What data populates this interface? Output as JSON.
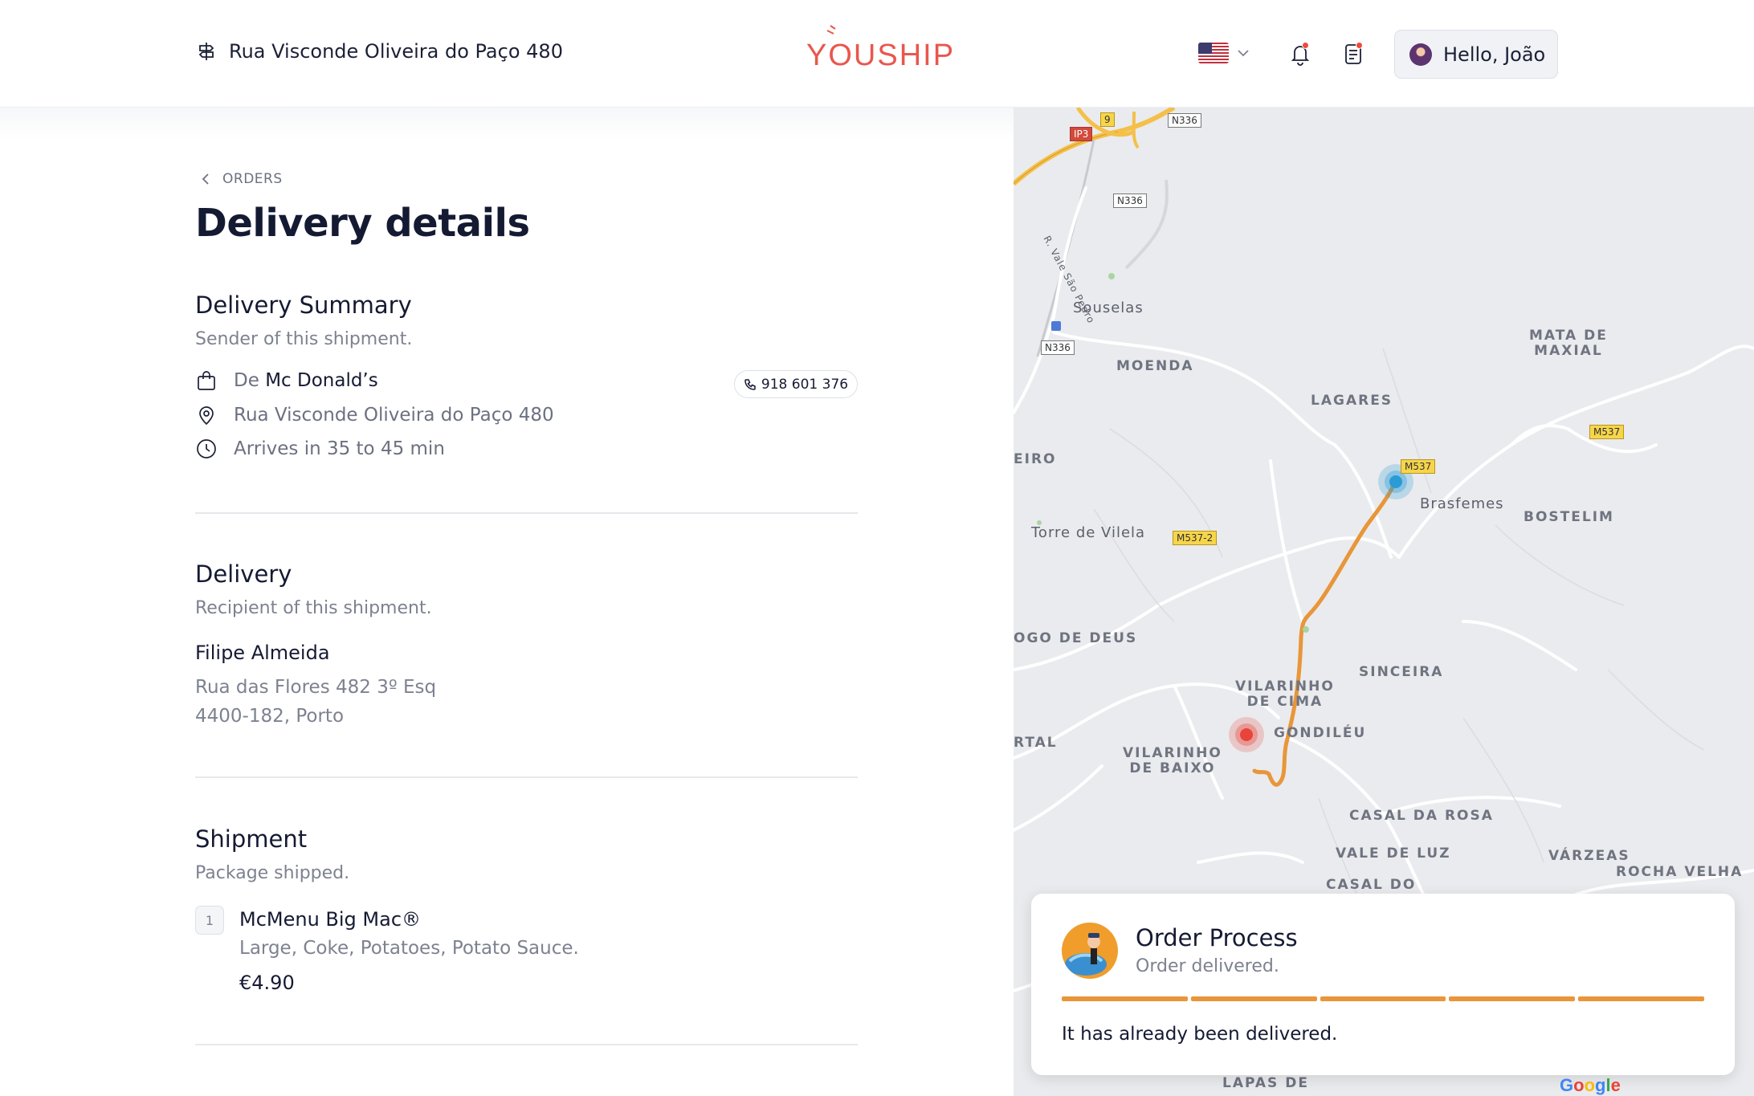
{
  "header": {
    "address": "Rua Visconde Oliveira do Paço 480",
    "brand": "YOUSHIP",
    "language_flag": "us-flag-icon",
    "greeting": "Hello, João"
  },
  "page": {
    "back_label": "ORDERS",
    "title": "Delivery details"
  },
  "summary": {
    "title": "Delivery Summary",
    "subtitle": "Sender of this shipment.",
    "from_prefix": "De",
    "from_name": "Mc Donald’s",
    "phone": "918 601 376",
    "address": "Rua Visconde Oliveira do Paço 480",
    "eta": "Arrives in 35 to 45 min"
  },
  "delivery": {
    "title": "Delivery",
    "subtitle": "Recipient of this shipment.",
    "recipient": "Filipe Almeida",
    "address_line1": "Rua das Flores 482 3º Esq",
    "address_line2": "4400-182, Porto"
  },
  "shipment": {
    "title": "Shipment",
    "subtitle": "Package shipped.",
    "item": {
      "qty": "1",
      "name": "McMenu Big Mac®",
      "desc": "Large, Coke, Potatoes, Potato Sauce.",
      "price": "€4.90"
    }
  },
  "map": {
    "places": {
      "souselas": "Souselas",
      "moenda": "MOENDA",
      "lagares": "LAGARES",
      "mata": "MATA DE\nMAXIAL",
      "brasfemes": "Brasfemes",
      "bostelim": "BOSTELIM",
      "eiro": "EIRO",
      "torre": "Torre de Vilela",
      "ogo": "OGO DE DEUS",
      "vilarinho_cima": "VILARINHO\nDE CIMA",
      "sinceira": "SINCEIRA",
      "gondileu": "GONDILÉU",
      "rtal": "RTAL",
      "vilarinho_baixo": "VILARINHO\nDE BAIXO",
      "casal_rosa": "CASAL DA ROSA",
      "vale_luz": "VALE DE LUZ",
      "varzeas": "VÁRZEAS",
      "rocha": "ROCHA VELHA",
      "casal_do": "CASAL DO",
      "lapas": "LAPAS DE",
      "street": "R. Vale São Pedro"
    },
    "roads": {
      "n336a": "N336",
      "n336b": "N336",
      "n336c": "N336",
      "ip3": "IP3",
      "nine": "9",
      "m537a": "M537",
      "m537b": "M537",
      "m5372": "M537-2"
    },
    "attribution": "Google",
    "colors": {
      "route": "#e8963a",
      "origin": "#2b9bd6",
      "destination": "#e9443a"
    }
  },
  "order_process": {
    "title": "Order Process",
    "status": "Order delivered.",
    "progress_steps_total": 5,
    "progress_steps_done": 5,
    "message": "It has already been delivered."
  }
}
